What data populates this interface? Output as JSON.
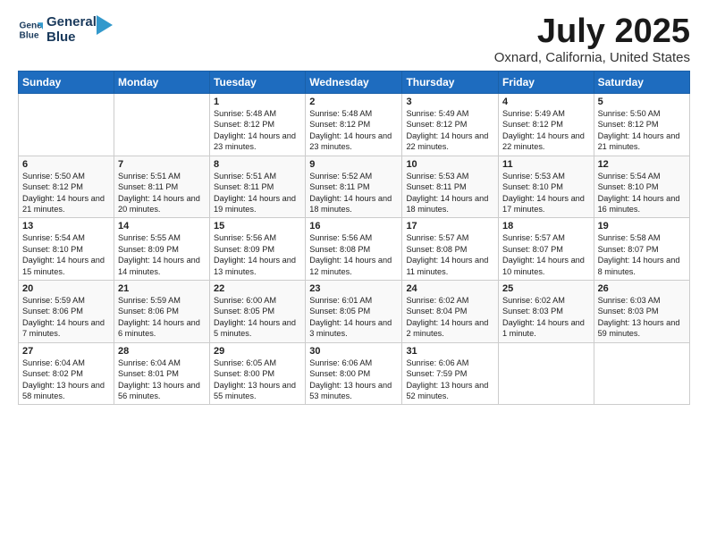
{
  "logo": {
    "line1": "General",
    "line2": "Blue"
  },
  "title": "July 2025",
  "location": "Oxnard, California, United States",
  "days_of_week": [
    "Sunday",
    "Monday",
    "Tuesday",
    "Wednesday",
    "Thursday",
    "Friday",
    "Saturday"
  ],
  "weeks": [
    [
      {
        "num": "",
        "sunrise": "",
        "sunset": "",
        "daylight": ""
      },
      {
        "num": "",
        "sunrise": "",
        "sunset": "",
        "daylight": ""
      },
      {
        "num": "1",
        "sunrise": "Sunrise: 5:48 AM",
        "sunset": "Sunset: 8:12 PM",
        "daylight": "Daylight: 14 hours and 23 minutes."
      },
      {
        "num": "2",
        "sunrise": "Sunrise: 5:48 AM",
        "sunset": "Sunset: 8:12 PM",
        "daylight": "Daylight: 14 hours and 23 minutes."
      },
      {
        "num": "3",
        "sunrise": "Sunrise: 5:49 AM",
        "sunset": "Sunset: 8:12 PM",
        "daylight": "Daylight: 14 hours and 22 minutes."
      },
      {
        "num": "4",
        "sunrise": "Sunrise: 5:49 AM",
        "sunset": "Sunset: 8:12 PM",
        "daylight": "Daylight: 14 hours and 22 minutes."
      },
      {
        "num": "5",
        "sunrise": "Sunrise: 5:50 AM",
        "sunset": "Sunset: 8:12 PM",
        "daylight": "Daylight: 14 hours and 21 minutes."
      }
    ],
    [
      {
        "num": "6",
        "sunrise": "Sunrise: 5:50 AM",
        "sunset": "Sunset: 8:12 PM",
        "daylight": "Daylight: 14 hours and 21 minutes."
      },
      {
        "num": "7",
        "sunrise": "Sunrise: 5:51 AM",
        "sunset": "Sunset: 8:11 PM",
        "daylight": "Daylight: 14 hours and 20 minutes."
      },
      {
        "num": "8",
        "sunrise": "Sunrise: 5:51 AM",
        "sunset": "Sunset: 8:11 PM",
        "daylight": "Daylight: 14 hours and 19 minutes."
      },
      {
        "num": "9",
        "sunrise": "Sunrise: 5:52 AM",
        "sunset": "Sunset: 8:11 PM",
        "daylight": "Daylight: 14 hours and 18 minutes."
      },
      {
        "num": "10",
        "sunrise": "Sunrise: 5:53 AM",
        "sunset": "Sunset: 8:11 PM",
        "daylight": "Daylight: 14 hours and 18 minutes."
      },
      {
        "num": "11",
        "sunrise": "Sunrise: 5:53 AM",
        "sunset": "Sunset: 8:10 PM",
        "daylight": "Daylight: 14 hours and 17 minutes."
      },
      {
        "num": "12",
        "sunrise": "Sunrise: 5:54 AM",
        "sunset": "Sunset: 8:10 PM",
        "daylight": "Daylight: 14 hours and 16 minutes."
      }
    ],
    [
      {
        "num": "13",
        "sunrise": "Sunrise: 5:54 AM",
        "sunset": "Sunset: 8:10 PM",
        "daylight": "Daylight: 14 hours and 15 minutes."
      },
      {
        "num": "14",
        "sunrise": "Sunrise: 5:55 AM",
        "sunset": "Sunset: 8:09 PM",
        "daylight": "Daylight: 14 hours and 14 minutes."
      },
      {
        "num": "15",
        "sunrise": "Sunrise: 5:56 AM",
        "sunset": "Sunset: 8:09 PM",
        "daylight": "Daylight: 14 hours and 13 minutes."
      },
      {
        "num": "16",
        "sunrise": "Sunrise: 5:56 AM",
        "sunset": "Sunset: 8:08 PM",
        "daylight": "Daylight: 14 hours and 12 minutes."
      },
      {
        "num": "17",
        "sunrise": "Sunrise: 5:57 AM",
        "sunset": "Sunset: 8:08 PM",
        "daylight": "Daylight: 14 hours and 11 minutes."
      },
      {
        "num": "18",
        "sunrise": "Sunrise: 5:57 AM",
        "sunset": "Sunset: 8:07 PM",
        "daylight": "Daylight: 14 hours and 10 minutes."
      },
      {
        "num": "19",
        "sunrise": "Sunrise: 5:58 AM",
        "sunset": "Sunset: 8:07 PM",
        "daylight": "Daylight: 14 hours and 8 minutes."
      }
    ],
    [
      {
        "num": "20",
        "sunrise": "Sunrise: 5:59 AM",
        "sunset": "Sunset: 8:06 PM",
        "daylight": "Daylight: 14 hours and 7 minutes."
      },
      {
        "num": "21",
        "sunrise": "Sunrise: 5:59 AM",
        "sunset": "Sunset: 8:06 PM",
        "daylight": "Daylight: 14 hours and 6 minutes."
      },
      {
        "num": "22",
        "sunrise": "Sunrise: 6:00 AM",
        "sunset": "Sunset: 8:05 PM",
        "daylight": "Daylight: 14 hours and 5 minutes."
      },
      {
        "num": "23",
        "sunrise": "Sunrise: 6:01 AM",
        "sunset": "Sunset: 8:05 PM",
        "daylight": "Daylight: 14 hours and 3 minutes."
      },
      {
        "num": "24",
        "sunrise": "Sunrise: 6:02 AM",
        "sunset": "Sunset: 8:04 PM",
        "daylight": "Daylight: 14 hours and 2 minutes."
      },
      {
        "num": "25",
        "sunrise": "Sunrise: 6:02 AM",
        "sunset": "Sunset: 8:03 PM",
        "daylight": "Daylight: 14 hours and 1 minute."
      },
      {
        "num": "26",
        "sunrise": "Sunrise: 6:03 AM",
        "sunset": "Sunset: 8:03 PM",
        "daylight": "Daylight: 13 hours and 59 minutes."
      }
    ],
    [
      {
        "num": "27",
        "sunrise": "Sunrise: 6:04 AM",
        "sunset": "Sunset: 8:02 PM",
        "daylight": "Daylight: 13 hours and 58 minutes."
      },
      {
        "num": "28",
        "sunrise": "Sunrise: 6:04 AM",
        "sunset": "Sunset: 8:01 PM",
        "daylight": "Daylight: 13 hours and 56 minutes."
      },
      {
        "num": "29",
        "sunrise": "Sunrise: 6:05 AM",
        "sunset": "Sunset: 8:00 PM",
        "daylight": "Daylight: 13 hours and 55 minutes."
      },
      {
        "num": "30",
        "sunrise": "Sunrise: 6:06 AM",
        "sunset": "Sunset: 8:00 PM",
        "daylight": "Daylight: 13 hours and 53 minutes."
      },
      {
        "num": "31",
        "sunrise": "Sunrise: 6:06 AM",
        "sunset": "Sunset: 7:59 PM",
        "daylight": "Daylight: 13 hours and 52 minutes."
      },
      {
        "num": "",
        "sunrise": "",
        "sunset": "",
        "daylight": ""
      },
      {
        "num": "",
        "sunrise": "",
        "sunset": "",
        "daylight": ""
      }
    ]
  ]
}
